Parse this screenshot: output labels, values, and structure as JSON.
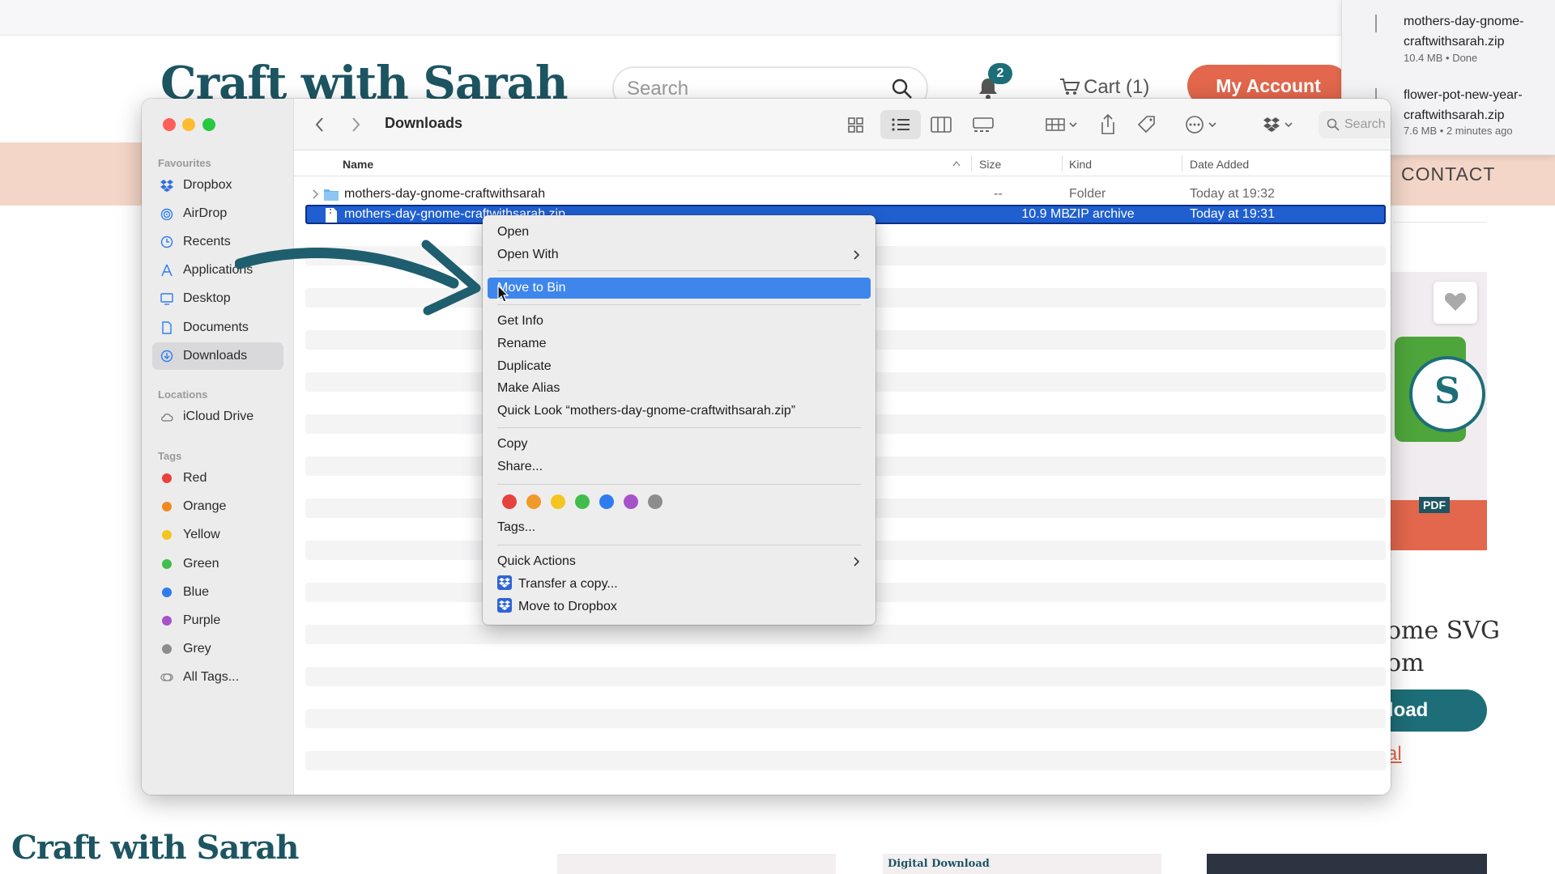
{
  "website": {
    "logo": "Craft with Sarah",
    "search_placeholder": "Search",
    "notification_count": "2",
    "cart_label": "Cart (1)",
    "my_account_label": "My Account",
    "nav_contact": "CONTACT",
    "product_title_line1": "ome SVG",
    "product_title_line2": "om",
    "download_button": "load",
    "link_fragment": "al",
    "product_badge": "PDF",
    "bottom_logo": "Craft with Sarah",
    "thumb_label": "Digital Download",
    "colors": {
      "brand_teal": "#1d6e78",
      "account_orange": "#e2674c",
      "band_peach": "#f4d6c8"
    }
  },
  "downloads_popup": {
    "items": [
      {
        "name": "mothers-day-gnome-craftwithsarah.zip",
        "meta": "10.4 MB • Done"
      },
      {
        "name": "flower-pot-new-year-craftwithsarah.zip",
        "meta": "7.6 MB • 2 minutes ago"
      }
    ]
  },
  "finder": {
    "title": "Downloads",
    "search_placeholder": "Search",
    "sidebar": {
      "favourites_heading": "Favourites",
      "favourites": [
        {
          "label": "Dropbox",
          "icon": "dropbox-icon"
        },
        {
          "label": "AirDrop",
          "icon": "airdrop-icon"
        },
        {
          "label": "Recents",
          "icon": "clock-icon"
        },
        {
          "label": "Applications",
          "icon": "applications-icon"
        },
        {
          "label": "Desktop",
          "icon": "desktop-icon"
        },
        {
          "label": "Documents",
          "icon": "document-icon"
        },
        {
          "label": "Downloads",
          "icon": "download-icon",
          "active": true
        }
      ],
      "locations_heading": "Locations",
      "locations": [
        {
          "label": "iCloud Drive",
          "icon": "cloud-icon"
        }
      ],
      "tags_heading": "Tags",
      "tags": [
        {
          "label": "Red",
          "color": "#e8423c"
        },
        {
          "label": "Orange",
          "color": "#ef8a22"
        },
        {
          "label": "Yellow",
          "color": "#f4c51f"
        },
        {
          "label": "Green",
          "color": "#40bd4d"
        },
        {
          "label": "Blue",
          "color": "#2f7cf0"
        },
        {
          "label": "Purple",
          "color": "#a653c9"
        },
        {
          "label": "Grey",
          "color": "#8d8d8d"
        }
      ],
      "all_tags": "All Tags..."
    },
    "columns": {
      "name": "Name",
      "size": "Size",
      "kind": "Kind",
      "date_added": "Date Added"
    },
    "files": [
      {
        "name": "mothers-day-gnome-craftwithsarah",
        "size": "--",
        "kind": "Folder",
        "date": "Today at 19:32",
        "selected": false
      },
      {
        "name": "mothers-day-gnome-craftwithsarah.zip",
        "size": "10.9 MB",
        "kind": "ZIP archive",
        "date": "Today at 19:31",
        "selected": true
      }
    ]
  },
  "context_menu": {
    "open": "Open",
    "open_with": "Open With",
    "move_to_bin": "Move to Bin",
    "get_info": "Get Info",
    "rename": "Rename",
    "duplicate": "Duplicate",
    "make_alias": "Make Alias",
    "quick_look": "Quick Look “mothers-day-gnome-craftwithsarah.zip”",
    "copy": "Copy",
    "share": "Share...",
    "tag_colors": [
      "#e8423c",
      "#ef9a2a",
      "#f4c51f",
      "#40bd4d",
      "#2f7cf0",
      "#a653c9",
      "#8d8d8d"
    ],
    "tags": "Tags...",
    "quick_actions": "Quick Actions",
    "transfer_copy": "Transfer a copy...",
    "move_to_dropbox": "Move to Dropbox",
    "highlight_color": "#3f86ec"
  },
  "selection_color": "#1f5fd0"
}
